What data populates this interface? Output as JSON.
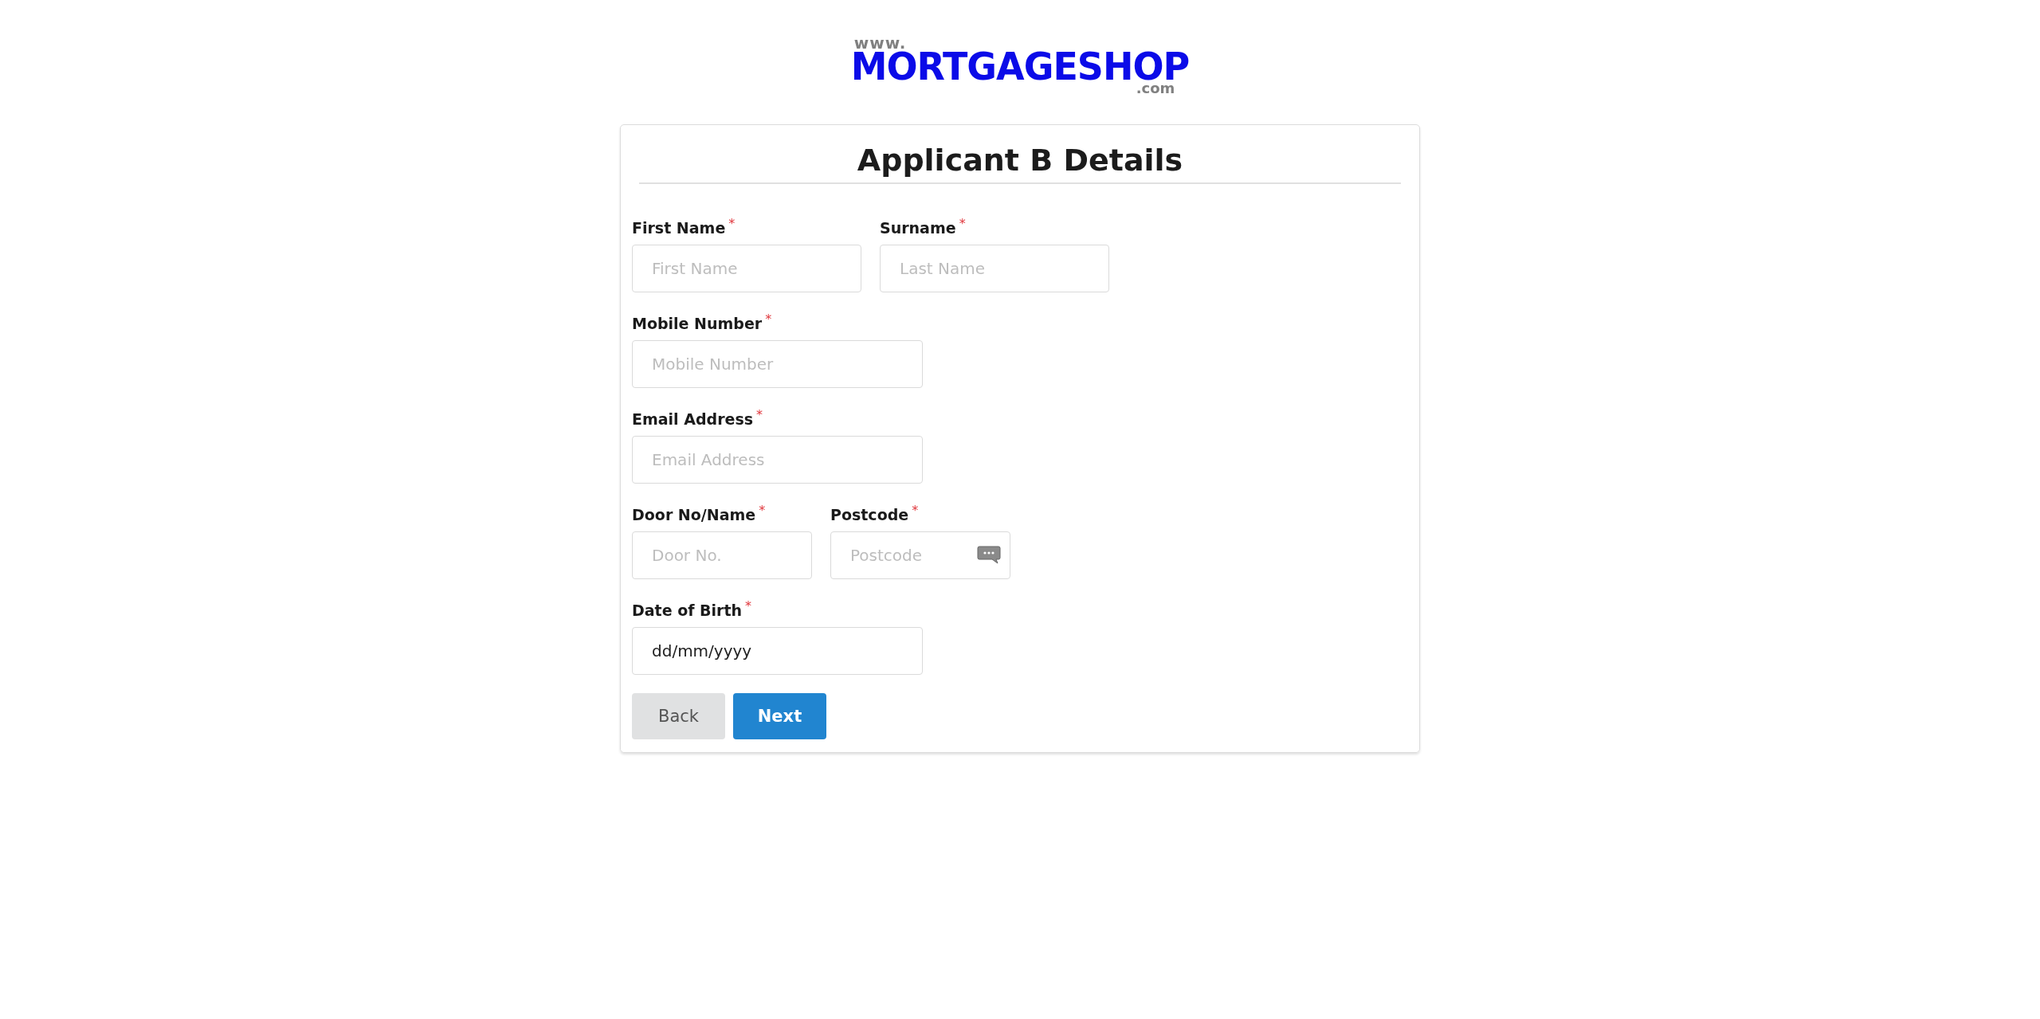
{
  "logo": {
    "prefix": "www.",
    "name": "MORTGAGESHOP",
    "suffix": ".com"
  },
  "form": {
    "title": "Applicant B Details",
    "rows": [
      {
        "fields": [
          {
            "kind": "text",
            "label": "First Name",
            "mark": "*",
            "placeholder": "First Name"
          },
          {
            "kind": "text",
            "label": "Surname",
            "mark": "*",
            "placeholder": "Last Name"
          }
        ]
      },
      {
        "fields": [
          {
            "kind": "text",
            "label": "Mobile Number",
            "mark": "*",
            "placeholder": "Mobile Number"
          }
        ]
      },
      {
        "fields": [
          {
            "kind": "text",
            "label": "Email Address",
            "mark": "*",
            "placeholder": "Email Address"
          }
        ]
      },
      {
        "fields": [
          {
            "kind": "text",
            "label": "Door No/Name",
            "mark": "*",
            "placeholder": "Door No."
          },
          {
            "kind": "lookup",
            "label": "Postcode",
            "mark": "*",
            "placeholder": "Postcode"
          }
        ]
      },
      {
        "fields": [
          {
            "kind": "date",
            "label": "Date of Birth",
            "mark": "*",
            "value": "dd/mm/yyyy"
          }
        ]
      }
    ],
    "buttons": [
      {
        "kind": "secondary",
        "label": "Back"
      },
      {
        "kind": "primary",
        "label": "Next"
      }
    ]
  }
}
